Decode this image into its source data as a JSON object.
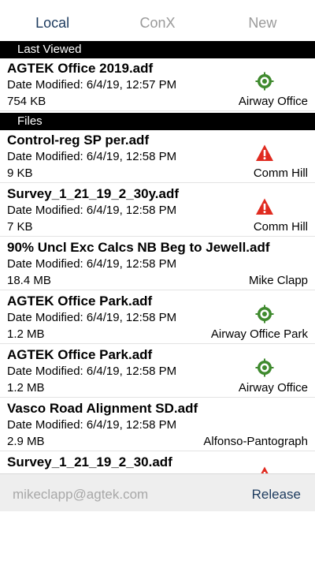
{
  "tabs": [
    {
      "label": "Local",
      "active": true
    },
    {
      "label": "ConX",
      "active": false
    },
    {
      "label": "New",
      "active": false
    }
  ],
  "sections": {
    "last_viewed": "Last Viewed",
    "files": "Files"
  },
  "last_viewed": [
    {
      "name": "AGTEK Office 2019.adf",
      "date": "Date Modified:  6/4/19, 12:57 PM",
      "size": "754 KB",
      "project": "Airway Office",
      "status_icon": "target-icon"
    }
  ],
  "files": [
    {
      "name": "Control-reg SP per.adf",
      "date": "Date Modified:  6/4/19, 12:58 PM",
      "size": "9 KB",
      "project": "Comm Hill",
      "status_icon": "warning-icon"
    },
    {
      "name": "Survey_1_21_19_2_30y.adf",
      "date": "Date Modified:  6/4/19, 12:58 PM",
      "size": "7 KB",
      "project": "Comm Hill",
      "status_icon": "warning-icon"
    },
    {
      "name": "90% Uncl Exc Calcs NB Beg to Jewell.adf",
      "date": "Date Modified:  6/4/19, 12:58 PM",
      "size": "18.4 MB",
      "project": "Mike Clapp",
      "status_icon": ""
    },
    {
      "name": "AGTEK Office Park.adf",
      "date": "Date Modified:  6/4/19, 12:58 PM",
      "size": "1.2 MB",
      "project": "Airway Office Park",
      "status_icon": "target-icon"
    },
    {
      "name": "AGTEK Office Park.adf",
      "date": "Date Modified:  6/4/19, 12:58 PM",
      "size": "1.2 MB",
      "project": "Airway Office",
      "status_icon": "target-icon"
    },
    {
      "name": "Vasco Road Alignment SD.adf",
      "date": "Date Modified:  6/4/19, 12:58 PM",
      "size": "2.9 MB",
      "project": "Alfonso-Pantograph",
      "status_icon": ""
    },
    {
      "name": "Survey_1_21_19_2_30.adf",
      "date": "",
      "size": "",
      "project": "",
      "status_icon": "warning-icon"
    }
  ],
  "footer": {
    "email": "mikeclapp@agtek.com",
    "release_label": "Release"
  },
  "colors": {
    "accent": "#1c3a5e",
    "inactive_tab": "#9a9a9a",
    "target_green": "#3f8a2e",
    "warning_red": "#e02b20"
  }
}
